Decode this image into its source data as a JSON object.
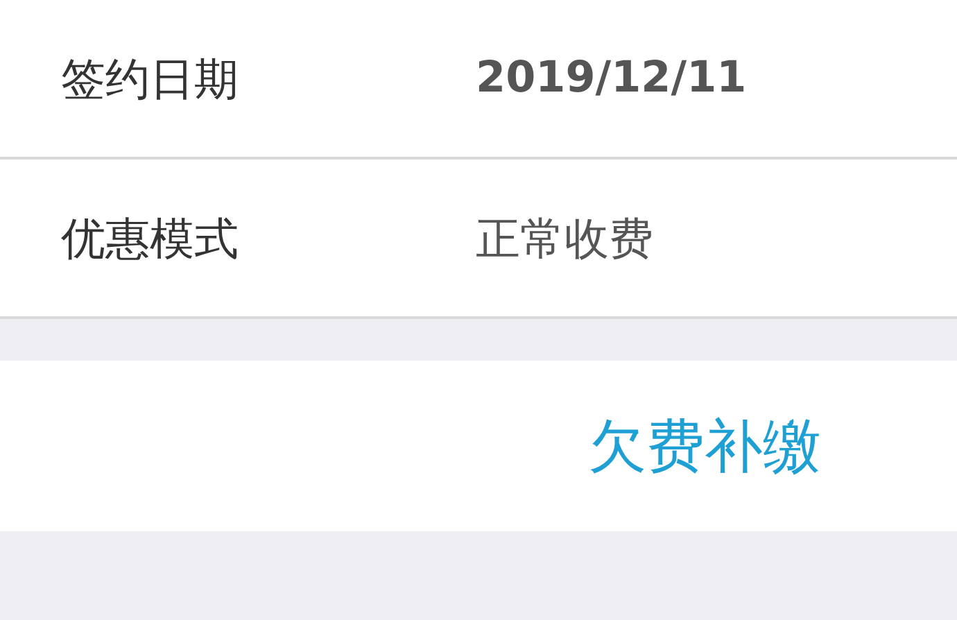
{
  "rows": [
    {
      "label": "签约日期",
      "value": "2019/12/11",
      "kind": "bold"
    },
    {
      "label": "优惠模式",
      "value": "正常收费",
      "kind": "plain"
    }
  ],
  "action": {
    "label": "欠费补缴"
  }
}
